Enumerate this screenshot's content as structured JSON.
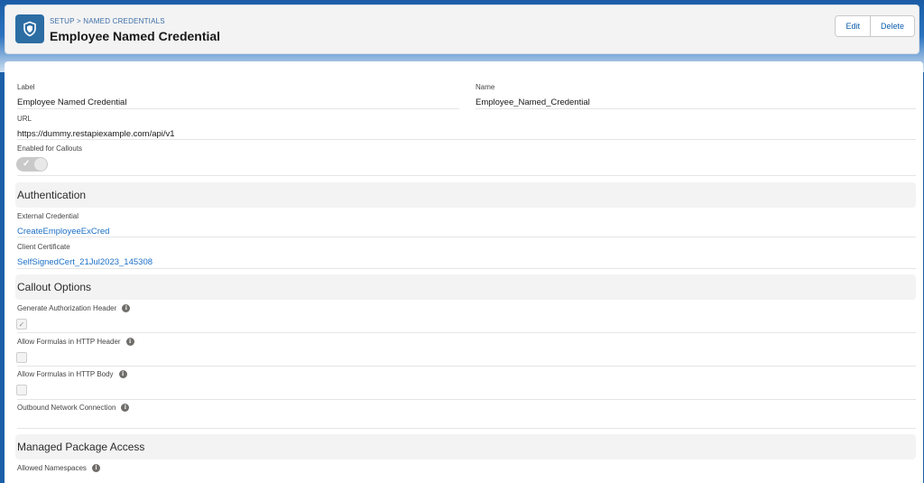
{
  "header": {
    "breadcrumb_root": "SETUP",
    "breadcrumb_sep": ">",
    "breadcrumb_current": "NAMED CREDENTIALS",
    "title": "Employee Named Credential",
    "edit_label": "Edit",
    "delete_label": "Delete",
    "icon": "shield-icon"
  },
  "details": {
    "label_label": "Label",
    "label_value": "Employee Named Credential",
    "name_label": "Name",
    "name_value": "Employee_Named_Credential",
    "url_label": "URL",
    "url_value": "https://dummy.restapiexample.com/api/v1",
    "enabled_label": "Enabled for Callouts",
    "enabled_value": true
  },
  "authentication": {
    "heading": "Authentication",
    "external_credential_label": "External Credential",
    "external_credential_value": "CreateEmployeeExCred",
    "client_certificate_label": "Client Certificate",
    "client_certificate_value": "SelfSignedCert_21Jul2023_145308"
  },
  "callout_options": {
    "heading": "Callout Options",
    "generate_auth_header_label": "Generate Authorization Header",
    "generate_auth_header_checked": true,
    "formulas_header_label": "Allow Formulas in HTTP Header",
    "formulas_header_checked": false,
    "formulas_body_label": "Allow Formulas in HTTP Body",
    "formulas_body_checked": false,
    "outbound_network_label": "Outbound Network Connection"
  },
  "managed_package": {
    "heading": "Managed Package Access",
    "allowed_namespaces_label": "Allowed Namespaces"
  },
  "colors": {
    "brand_blue": "#2c6da4",
    "link": "#1b6fc7"
  }
}
